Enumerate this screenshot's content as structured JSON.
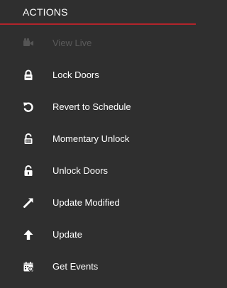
{
  "panel": {
    "title": "ACTIONS",
    "accent_color": "#b3242b"
  },
  "actions": [
    {
      "label": "View Live",
      "icon": "camera-icon",
      "enabled": false
    },
    {
      "label": "Lock Doors",
      "icon": "lock-icon",
      "enabled": true
    },
    {
      "label": "Revert to Schedule",
      "icon": "revert-icon",
      "enabled": true
    },
    {
      "label": "Momentary Unlock",
      "icon": "momentary-unlock-icon",
      "enabled": true
    },
    {
      "label": "Unlock Doors",
      "icon": "unlock-icon",
      "enabled": true
    },
    {
      "label": "Update Modified",
      "icon": "update-modified-icon",
      "enabled": true
    },
    {
      "label": "Update",
      "icon": "up-arrow-icon",
      "enabled": true
    },
    {
      "label": "Get Events",
      "icon": "events-icon",
      "enabled": true
    }
  ]
}
